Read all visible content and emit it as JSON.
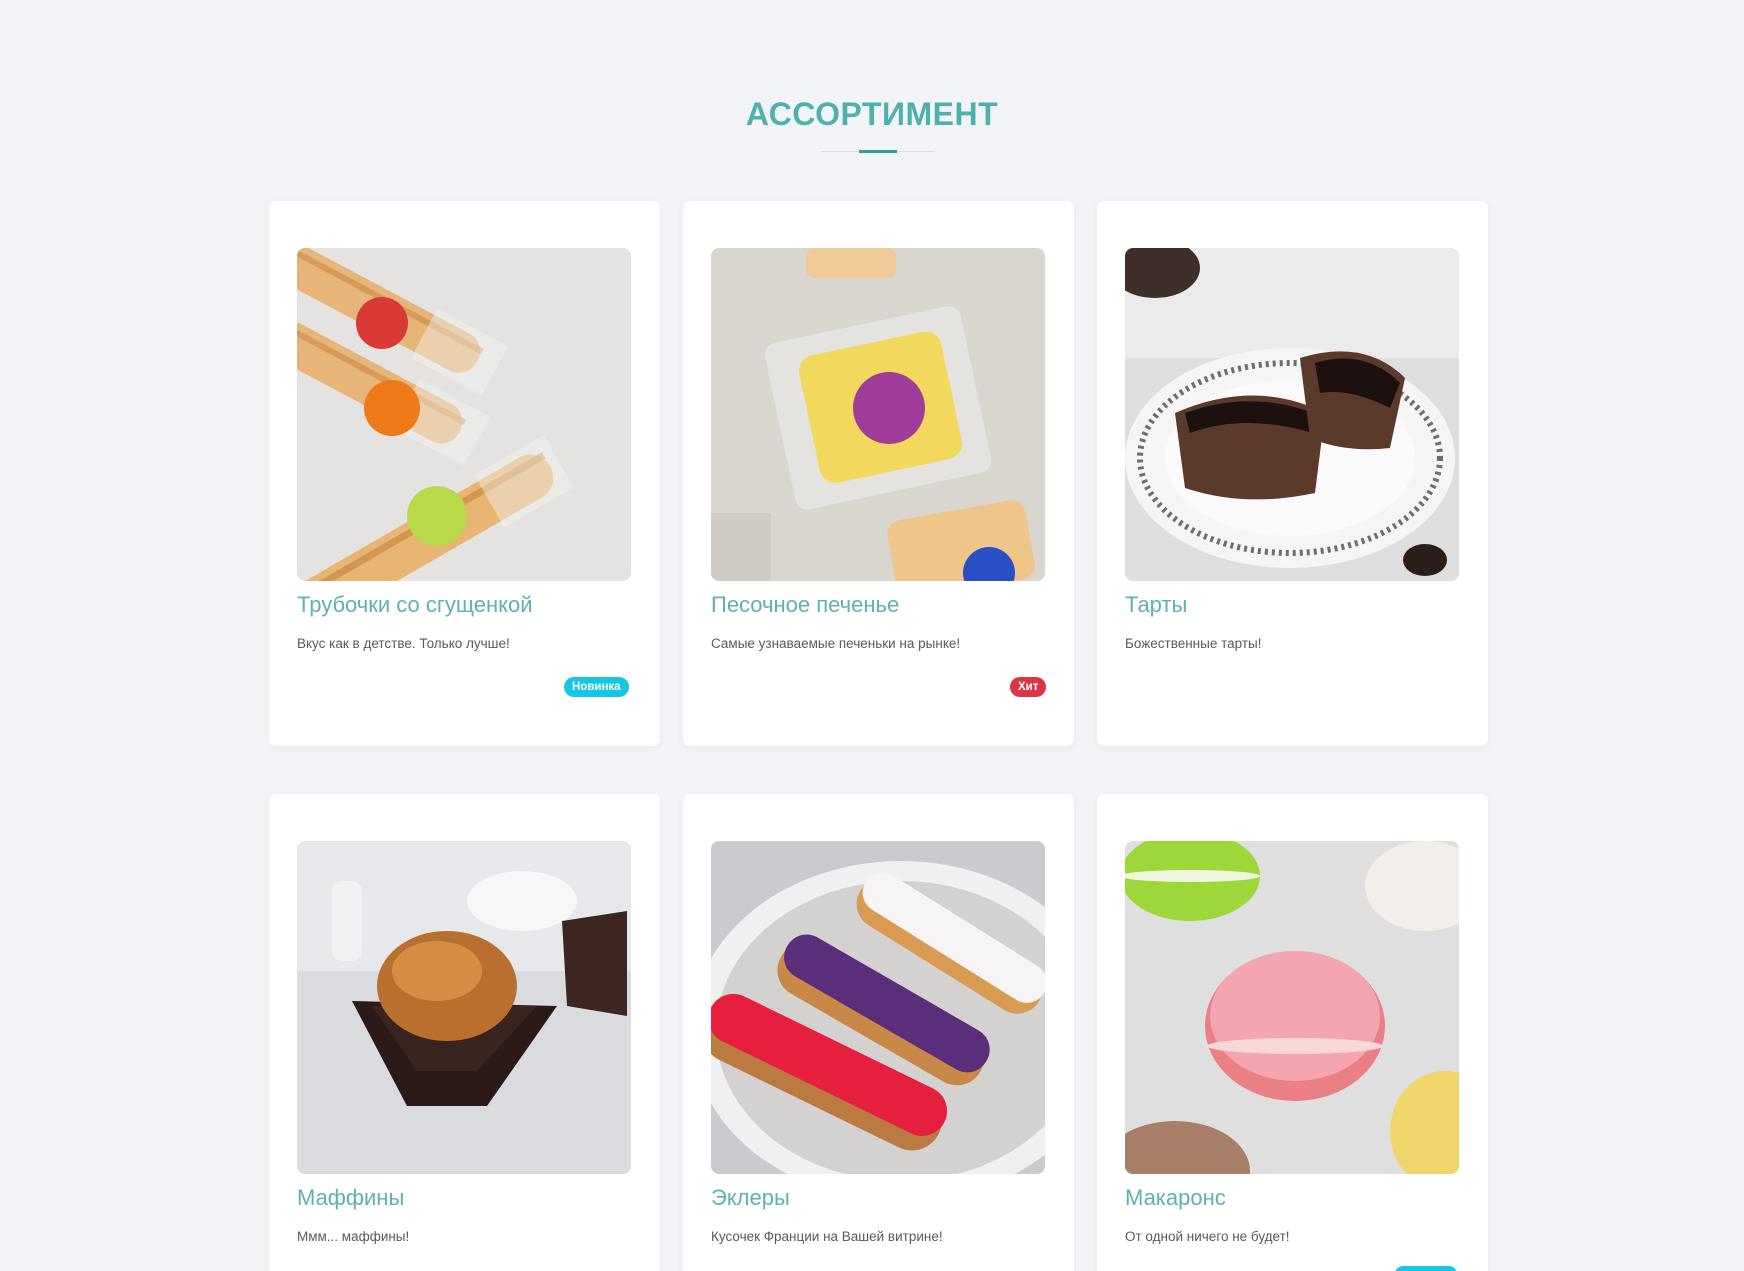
{
  "section": {
    "title": "АССОРТИМЕНТ"
  },
  "colors": {
    "accent": "#4fb1ad",
    "badge_new": "#16c6e6",
    "badge_hit": "#dc3545"
  },
  "products": [
    {
      "name": "Трубочки со сгущенкой",
      "description": "Вкус как в детстве. Только лучше!",
      "badge": "Новинка",
      "photo_icon": "wafer-rolls-photo"
    },
    {
      "name": "Песочное печенье",
      "description": "Самые узнаваемые печеньки на рынке!",
      "badge": "Хит",
      "photo_icon": "shortbread-photo"
    },
    {
      "name": "Тарты",
      "description": "Божественные тарты!",
      "badge": "",
      "photo_icon": "tarts-photo"
    },
    {
      "name": "Маффины",
      "description": "Ммм... маффины!",
      "badge": "",
      "photo_icon": "muffin-photo"
    },
    {
      "name": "Эклеры",
      "description": "Кусочек Франции на Вашей витрине!",
      "badge": "",
      "photo_icon": "eclairs-photo"
    },
    {
      "name": "Макаронс",
      "description": "От одной ничего не будет!",
      "badge": "",
      "photo_icon": "macarons-photo"
    }
  ]
}
